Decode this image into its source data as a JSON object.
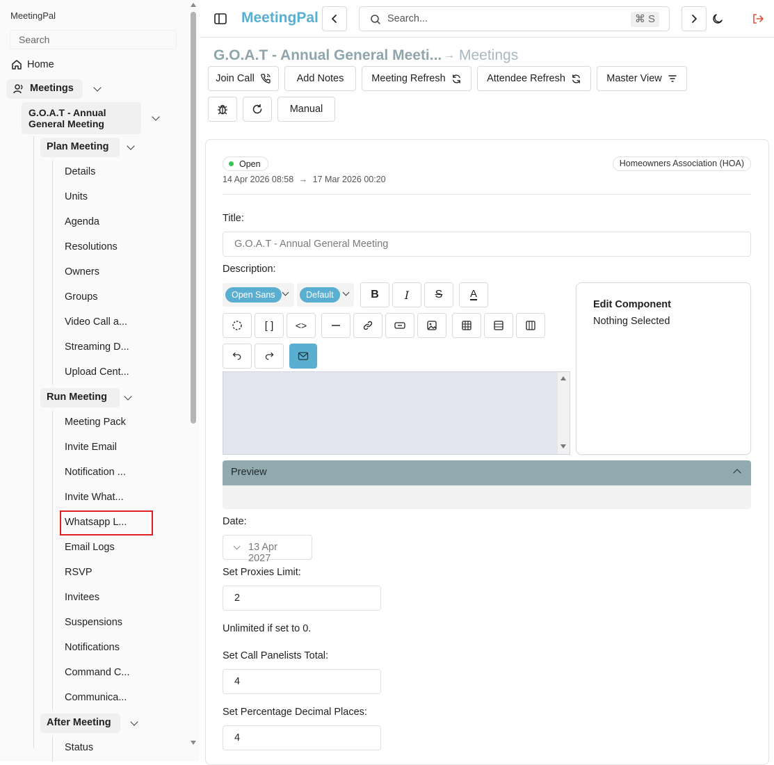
{
  "sidebar": {
    "app_name": "MeetingPal",
    "search_placeholder": "Search",
    "home": "Home",
    "meetings": "Meetings",
    "meeting_title_line1": "G.O.A.T - Annual",
    "meeting_title_line2": "General Meeting",
    "plan_meeting": "Plan Meeting",
    "plan_items": [
      "Details",
      "Units",
      "Agenda",
      "Resolutions",
      "Owners",
      "Groups",
      "Video Call a...",
      "Streaming D...",
      "Upload Cent..."
    ],
    "run_meeting": "Run Meeting",
    "run_items": [
      "Meeting Pack",
      "Invite Email",
      "Notification ...",
      "Invite What...",
      "Whatsapp L...",
      "Email Logs",
      "RSVP",
      "Invitees",
      "Suspensions",
      "Notifications",
      "Command C...",
      "Communica..."
    ],
    "after_meeting": "After Meeting",
    "after_items": [
      "Status"
    ]
  },
  "topbar": {
    "brand": "MeetingPal",
    "search_placeholder": "Search...",
    "shortcut": "⌘ S",
    "icons": [
      "sidebar-toggle-icon",
      "chevron-left-icon",
      "search-icon",
      "chevron-right-icon",
      "moon-icon",
      "logout-icon"
    ]
  },
  "breadcrumb": {
    "title": "G.O.A.T - Annual General Meeti...",
    "section": "Meetings"
  },
  "toolbar": {
    "join_call": "Join Call",
    "add_notes": "Add Notes",
    "meeting_refresh": "Meeting Refresh",
    "attendee_refresh": "Attendee Refresh",
    "master_view": "Master View",
    "manual": "Manual"
  },
  "meeting": {
    "status": "Open",
    "status_color": "#3cc454",
    "organization": "Homeowners Association (HOA)",
    "start": "14 Apr 2026 08:58",
    "end": "17 Mar 2026 00:20",
    "title_label": "Title:",
    "title_value": "G.O.A.T - Annual General Meeting",
    "description_label": "Description:",
    "date_label": "Date:",
    "date_value": "13 Apr 2027",
    "proxies_label": "Set Proxies Limit:",
    "proxies_value": "2",
    "proxies_hint": "Unlimited if set to 0.",
    "panelists_label": "Set Call Panelists Total:",
    "panelists_value": "4",
    "decimals_label": "Set Percentage Decimal Places:",
    "decimals_value": "4"
  },
  "editor": {
    "font": "Open Sans",
    "size": "Default",
    "accent": "#5aaed0",
    "edit_component_title": "Edit Component",
    "edit_component_status": "Nothing Selected",
    "preview_label": "Preview"
  }
}
